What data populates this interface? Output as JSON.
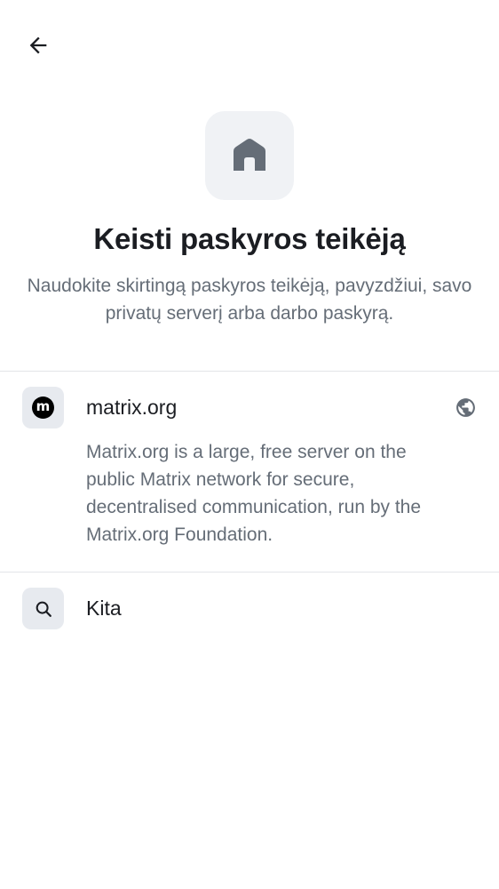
{
  "header": {
    "back_icon": "arrow-left-icon"
  },
  "hero": {
    "icon": "home-icon",
    "title": "Keisti paskyros teikėją",
    "subtitle": "Naudokite skirtingą paskyros teikėją, pavyzdžiui, savo privatų serverį arba darbo paskyrą."
  },
  "providers": [
    {
      "icon": "matrix-logo-icon",
      "icon_letter": "m",
      "label": "matrix.org",
      "trailing_icon": "globe-icon",
      "description": "Matrix.org is a large, free server on the public Matrix network for secure, decentralised communication, run by the Matrix.org Foundation."
    },
    {
      "icon": "search-icon",
      "label": "Kita"
    }
  ],
  "colors": {
    "text_primary": "#1b1d22",
    "text_secondary": "#656d77",
    "icon_bg": "#e7eaef",
    "hero_icon_bg": "#f0f2f5",
    "divider": "#e3e5e8"
  }
}
